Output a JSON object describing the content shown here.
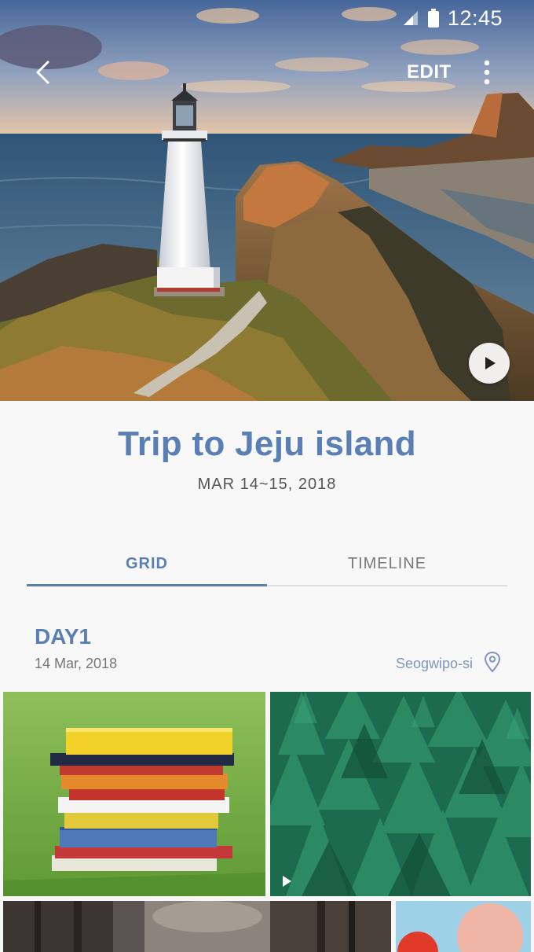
{
  "status_bar": {
    "time": "12:45",
    "icons": [
      "signal-icon",
      "battery-icon"
    ]
  },
  "toolbar": {
    "back_icon": "back-arrow-icon",
    "edit_label": "EDIT",
    "more_icon": "more-vertical-icon"
  },
  "hero": {
    "image": "lighthouse-coast-photo",
    "play_icon": "play-icon"
  },
  "album": {
    "title": "Trip to Jeju island",
    "dates": "MAR 14~15, 2018"
  },
  "tabs": [
    {
      "label": "GRID",
      "selected": true
    },
    {
      "label": "TIMELINE",
      "selected": false
    }
  ],
  "day": {
    "heading": "DAY1",
    "date": "14 Mar, 2018",
    "location": "Seogwipo-si",
    "location_icon": "location-pin-icon"
  },
  "photos": [
    {
      "subject": "book-stack-photo",
      "video": false
    },
    {
      "subject": "pine-forest-photo",
      "video": true
    },
    {
      "subject": "forest-road-photo",
      "video": false
    },
    {
      "subject": "balloon-photo",
      "video": false
    }
  ],
  "colors": {
    "accent": "#5a7fb5",
    "background": "#f8f8f8",
    "location_text": "#7e96bc"
  }
}
